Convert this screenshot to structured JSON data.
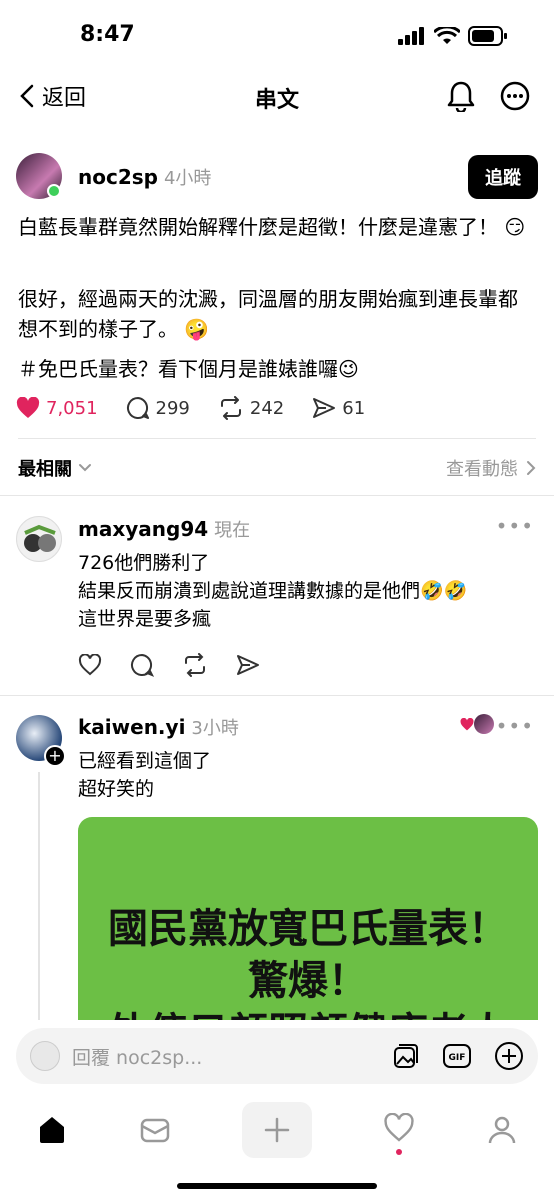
{
  "status_bar": {
    "time": "8:47"
  },
  "header": {
    "back_label": "返回",
    "title": "串文"
  },
  "post": {
    "username": "noc2sp",
    "time_ago": "4小時",
    "follow_label": "追蹤",
    "paragraphs": [
      "白藍長輩群竟然開始解釋什麼是超徵！什麼是違憲了！ 😏",
      "很好，經過兩天的沈澱，同溫層的朋友開始瘋到連長輩都想不到的樣子了。 🤪",
      "＃免巴氏量表？看下個月是誰婊誰囉😉"
    ],
    "likes": "7,051",
    "comments": "299",
    "reposts": "242",
    "shares": "61"
  },
  "sort": {
    "label": "最相關",
    "activity_label": "查看動態"
  },
  "comments": [
    {
      "username": "maxyang94",
      "time_ago": "現在",
      "lines": [
        "726他們勝利了",
        "結果反而崩潰到處說道理講數據的是他們🤣🤣",
        "這世界是要多瘋"
      ]
    },
    {
      "username": "kaiwen.yi",
      "time_ago": "3小時",
      "lines": [
        "已經看到這個了",
        "超好笑的"
      ],
      "image_lines": [
        "國民黨放寬巴氏量表！",
        "驚爆！",
        "外傭只顧照顧健康老人"
      ]
    }
  ],
  "reply": {
    "placeholder": "回覆 noc2sp..."
  },
  "colors": {
    "like": "#e0245e",
    "image_bg": "#6cbf45"
  }
}
